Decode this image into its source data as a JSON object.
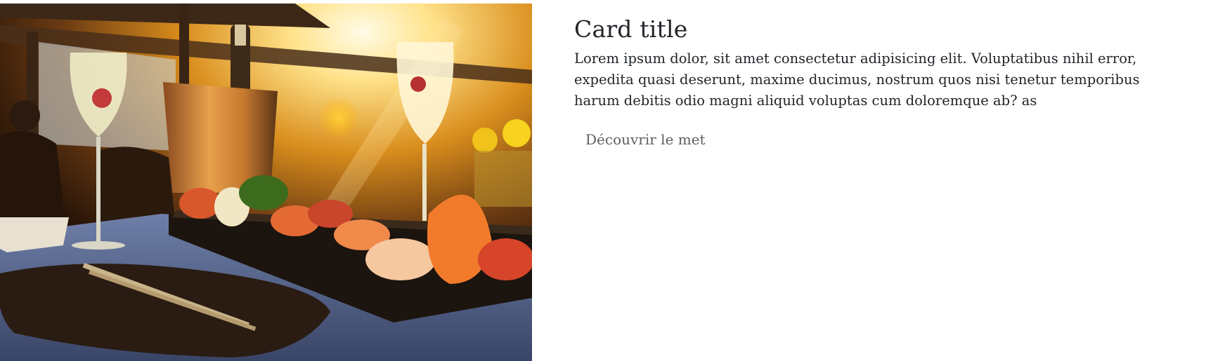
{
  "card": {
    "image_alt": "Sushi platter with champagne glasses on a sunlit terrace",
    "title": "Card title",
    "text": "Lorem ipsum dolor, sit amet consectetur adipisicing elit. Voluptatibus nihil error, expedita quasi deserunt, maxime ducimus, nostrum quos nisi tenetur temporibus harum debitis odio magni aliquid voluptas cum doloremque ab? as",
    "link_label": "Découvrir le met"
  }
}
